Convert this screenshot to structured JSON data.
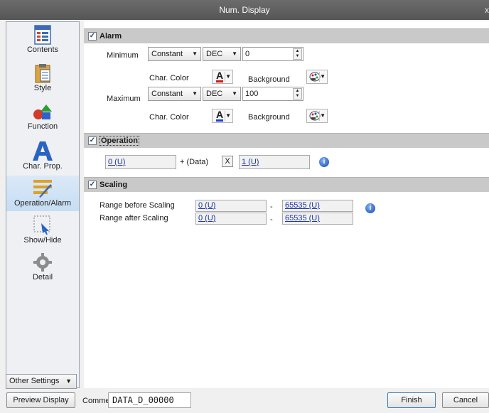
{
  "window": {
    "title": "Num. Display",
    "close_glyph": "x"
  },
  "sidebar": {
    "items": [
      {
        "label": "Contents",
        "icon": "contents-icon"
      },
      {
        "label": "Style",
        "icon": "style-icon"
      },
      {
        "label": "Function",
        "icon": "function-icon"
      },
      {
        "label": "Char. Prop.",
        "icon": "char-prop-icon"
      },
      {
        "label": "Operation/Alarm",
        "icon": "operation-alarm-icon",
        "active": true
      },
      {
        "label": "Show/Hide",
        "icon": "show-hide-icon"
      },
      {
        "label": "Detail",
        "icon": "detail-icon"
      }
    ],
    "other_settings": "Other Settings"
  },
  "alarm": {
    "header": "Alarm",
    "checked": true,
    "minimum": {
      "label": "Minimum",
      "source": "Constant",
      "format": "DEC",
      "value": "0",
      "char_color_label": "Char. Color",
      "char_color": "#d11a1a",
      "background_label": "Background"
    },
    "maximum": {
      "label": "Maximum",
      "source": "Constant",
      "format": "DEC",
      "value": "100",
      "char_color_label": "Char. Color",
      "char_color": "#1a3fd1",
      "background_label": "Background"
    }
  },
  "operation": {
    "header": "Operation",
    "checked": true,
    "offset": "0 (U)",
    "plus_data": "+ (Data)",
    "multiply": "X",
    "factor": "1 (U)"
  },
  "scaling": {
    "header": "Scaling",
    "checked": true,
    "before_label": "Range before Scaling",
    "before_min": "0 (U)",
    "before_max": "65535 (U)",
    "after_label": "Range after Scaling",
    "after_min": "0 (U)",
    "after_max": "65535 (U)",
    "dash": "-"
  },
  "footer": {
    "preview": "Preview Display",
    "comment_label": "Comme",
    "comment_value": "DATA_D_00000",
    "finish": "Finish",
    "cancel": "Cancel"
  },
  "colors": {
    "accent": "#3c7fb1",
    "link": "#1b33a8",
    "section_bg": "#c9c9c9",
    "active_nav": "#c6ddf4"
  }
}
